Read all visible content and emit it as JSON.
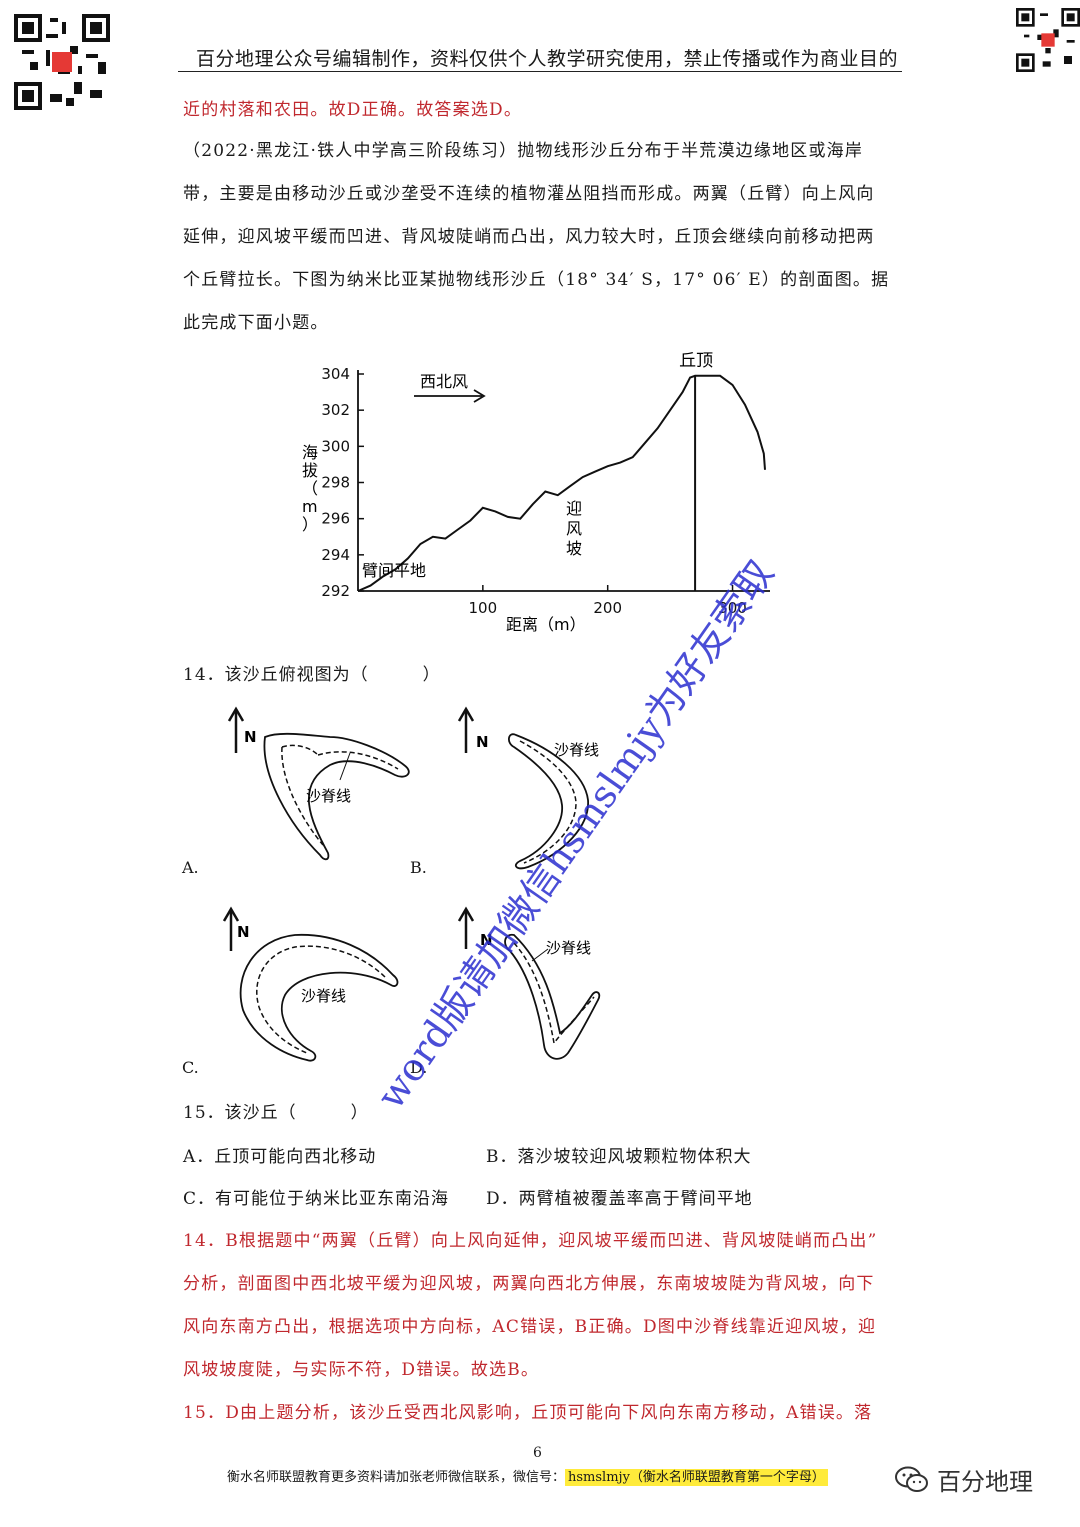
{
  "header": {
    "text": "百分地理公众号编辑制作，资料仅供个人教学研究使用，禁止传播或作为商业目的"
  },
  "intro_answer": "近的村落和农田。故D正确。故答案选D。",
  "question_paragraph": [
    "（2022·黑龙江·铁人中学高三阶段练习）抛物线形沙丘分布于半荒漠边缘地区或海岸",
    "带，主要是由移动沙丘或沙垄受不连续的植物灌丛阻挡而形成。两翼（丘臂）向上风向",
    "延伸，迎风坡平缓而凹进、背风坡陡峭而凸出，风力较大时，丘顶会继续向前移动把两",
    "个丘臂拉长。下图为纳米比亚某抛物线形沙丘（18° 34′ S，17° 06′ E）的剖面图。据",
    "此完成下面小题。"
  ],
  "chart_data": {
    "type": "line",
    "xlabel": "距离（m）",
    "ylabel": "海拔（m）",
    "xticks": [
      100,
      200,
      300
    ],
    "yticks": [
      292,
      294,
      296,
      298,
      300,
      302,
      304
    ],
    "xlim": [
      0,
      330
    ],
    "ylim": [
      292,
      304
    ],
    "x": [
      0,
      10,
      20,
      30,
      40,
      50,
      60,
      70,
      80,
      90,
      100,
      110,
      120,
      130,
      140,
      150,
      160,
      170,
      180,
      190,
      200,
      210,
      220,
      230,
      240,
      250,
      260,
      266,
      270,
      280,
      290,
      300,
      310,
      320,
      325,
      326
    ],
    "y": [
      292,
      292.3,
      292.8,
      293.2,
      293.8,
      294.6,
      295.0,
      294.9,
      295.4,
      295.9,
      296.6,
      296.4,
      296.1,
      296.0,
      296.8,
      297.5,
      297.3,
      297.8,
      298.3,
      298.6,
      298.9,
      299.1,
      299.4,
      300.2,
      301.0,
      302.0,
      303.0,
      303.8,
      303.9,
      303.9,
      303.9,
      303.4,
      302.3,
      300.8,
      299.6,
      298.7
    ],
    "annotations": {
      "crest": "丘顶",
      "wind": "西北风",
      "windward": "迎风坡",
      "flat": "臂间平地"
    }
  },
  "q14": {
    "stem": "14．该沙丘俯视图为（　　　）",
    "labels": [
      "A.",
      "B.",
      "C.",
      "D."
    ],
    "north": "N",
    "ridge": "沙脊线"
  },
  "q15": {
    "stem": "15．该沙丘（　　　）",
    "options": [
      "A．丘顶可能向西北移动",
      "B．落沙坡较迎风坡颗粒物体积大",
      "C．有可能位于纳米比亚东南沿海",
      "D．两臂植被覆盖率高于臂间平地"
    ]
  },
  "answers": [
    "14．B根据题中“两翼（丘臂）向上风向延伸，迎风坡平缓而凹进、背风坡陡峭而凸出”",
    "分析，剖面图中西北坡平缓为迎风坡，两翼向西北方伸展，东南坡坡陡为背风坡，向下",
    "风向东南方凸出，根据选项中方向标，AC错误，B正确。D图中沙脊线靠近迎风坡，迎",
    "风坡坡度陡，与实际不符，D错误。故选B。",
    "15．D由上题分析，该沙丘受西北风影响，丘顶可能向下风向东南方移动，A错误。落"
  ],
  "footer": {
    "text": "衡水名师联盟教育更多资料请加张老师微信联系，微信号：",
    "highlight": "hsmslmjy（衡水名师联盟教育第一个字母）",
    "page": "6"
  },
  "brand": {
    "text": "百分地理"
  },
  "watermark": "word版请加微信hsmslmjy为好友索取"
}
